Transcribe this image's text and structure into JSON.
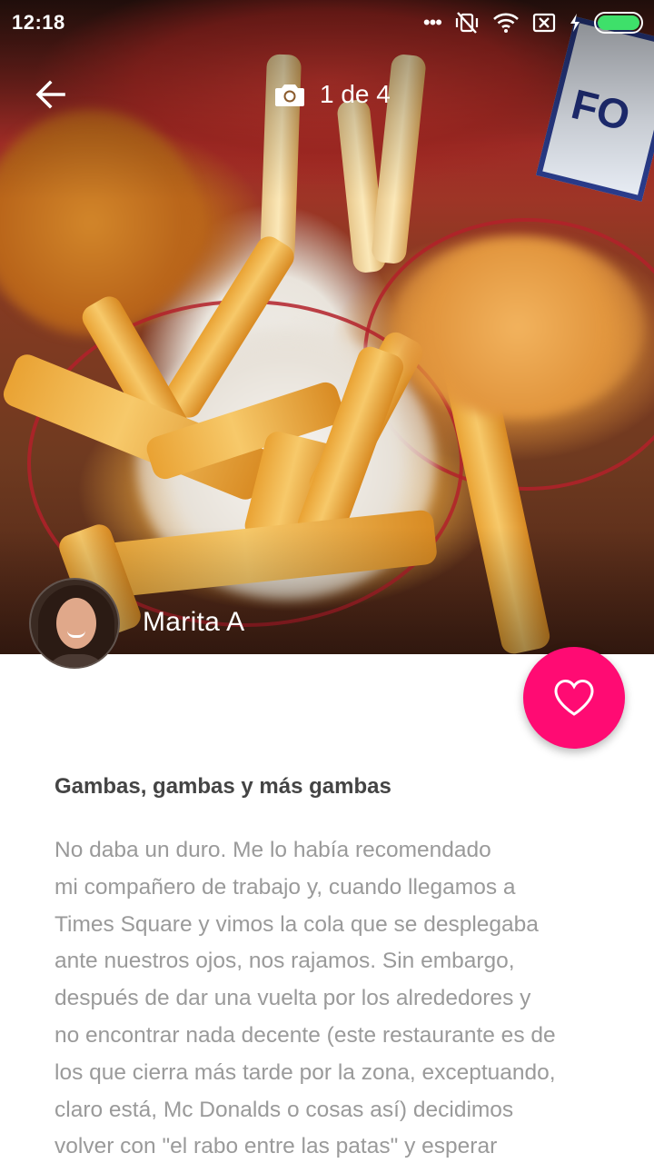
{
  "status_bar": {
    "time": "12:18",
    "icons": [
      "more-dots-icon",
      "vibrate-off-icon",
      "wifi-icon",
      "sim-off-icon",
      "charging-icon",
      "battery-icon"
    ],
    "battery_color": "#3ee06a"
  },
  "header": {
    "back_icon": "arrow-left-icon",
    "camera_icon": "camera-icon",
    "photo_counter": "1 de 4"
  },
  "author": {
    "name": "Marita A"
  },
  "like_button": {
    "icon": "heart-outline-icon",
    "color": "#ff0b73"
  },
  "review": {
    "title": "Gambas, gambas y más gambas",
    "body_lines": [
      "No daba un duro. Me lo había recomendado",
      "mi compañero de trabajo y, cuando llegamos a",
      "Times Square y vimos la cola que se desplegaba",
      "ante nuestros ojos, nos rajamos. Sin embargo,",
      "después de dar una vuelta por los alrededores y",
      "no encontrar nada decente (este restaurante es de",
      "los que cierra más tarde por la zona, exceptuando,",
      "claro está, Mc Donalds o cosas así) decidimos",
      "volver con \"el rabo entre las patas\" y esperar"
    ]
  }
}
